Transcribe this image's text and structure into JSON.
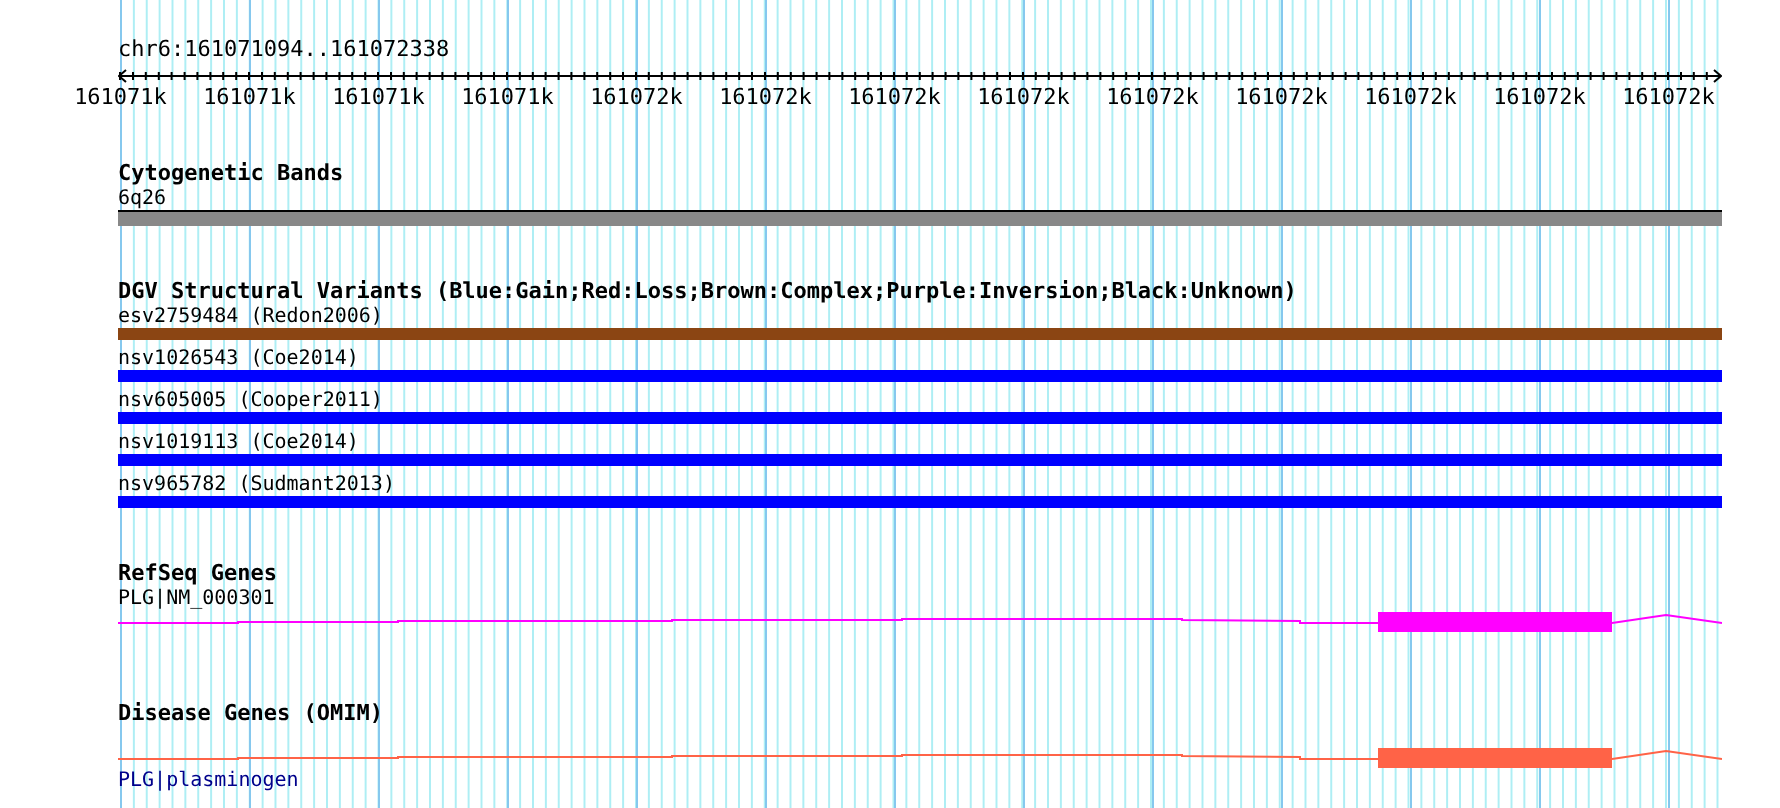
{
  "locus": "chr6:161071094..161072338",
  "ruler": {
    "labels": [
      "161071k",
      "161071k",
      "161071k",
      "161071k",
      "161072k",
      "161072k",
      "161072k",
      "161072k",
      "161072k",
      "161072k",
      "161072k",
      "161072k",
      "161072k"
    ]
  },
  "tracks": [
    {
      "kind": "bands",
      "title": "Cytogenetic Bands",
      "features": [
        {
          "label": "6q26"
        }
      ]
    },
    {
      "kind": "variants",
      "title": "DGV Structural Variants (Blue:Gain;Red:Loss;Brown:Complex;Purple:Inversion;Black:Unknown)",
      "features": [
        {
          "label": "esv2759484 (Redon2006)",
          "color": "#8b4513"
        },
        {
          "label": "nsv1026543 (Coe2014)",
          "color": "#0000ff"
        },
        {
          "label": "nsv605005 (Cooper2011)",
          "color": "#0000ff"
        },
        {
          "label": "nsv1019113 (Coe2014)",
          "color": "#0000ff"
        },
        {
          "label": "nsv965782 (Sudmant2013)",
          "color": "#0000ff"
        }
      ]
    },
    {
      "kind": "gene",
      "title": "RefSeq Genes",
      "features": [
        {
          "label": "PLG|NM_000301",
          "link": false,
          "color": "#ff00ff"
        }
      ]
    },
    {
      "kind": "gene",
      "title": "Disease Genes (OMIM)",
      "features": [
        {
          "label": "PLG|plasminogen",
          "link": true,
          "color": "#ff6347"
        }
      ]
    }
  ]
}
